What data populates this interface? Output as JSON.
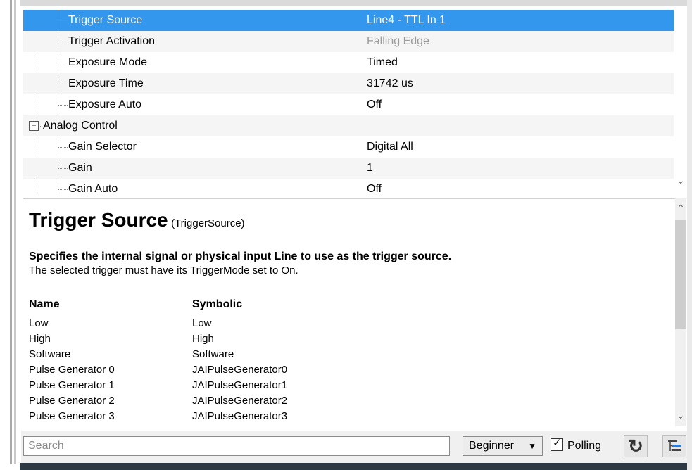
{
  "property_grid": {
    "rows": [
      {
        "name": "Trigger Source",
        "value": "Line4 - TTL In 1",
        "selected": true
      },
      {
        "name": "Trigger Activation",
        "value": "Falling Edge",
        "disabled": true
      },
      {
        "name": "Exposure Mode",
        "value": "Timed"
      },
      {
        "name": "Exposure Time",
        "value": "31742 us"
      },
      {
        "name": "Exposure Auto",
        "value": "Off"
      },
      {
        "name": "Analog Control",
        "category": true,
        "expanded": true
      },
      {
        "name": "Gain Selector",
        "value": "Digital All"
      },
      {
        "name": "Gain",
        "value": "1"
      },
      {
        "name": "Gain Auto",
        "value": "Off"
      }
    ]
  },
  "description": {
    "title": "Trigger Source",
    "symbol": "(TriggerSource)",
    "summary": "Specifies the internal signal or physical input Line to use as the trigger source.",
    "detail": "The selected trigger must have its TriggerMode set to On.",
    "columns": [
      "Name",
      "Symbolic"
    ],
    "entries": [
      [
        "Low",
        "Low"
      ],
      [
        "High",
        "High"
      ],
      [
        "Software",
        "Software"
      ],
      [
        "Pulse Generator 0",
        "JAIPulseGenerator0"
      ],
      [
        "Pulse Generator 1",
        "JAIPulseGenerator1"
      ],
      [
        "Pulse Generator 2",
        "JAIPulseGenerator2"
      ],
      [
        "Pulse Generator 3",
        "JAIPulseGenerator3"
      ]
    ]
  },
  "toolbar": {
    "search_placeholder": "Search",
    "visibility_level": "Beginner",
    "polling_label": "Polling",
    "polling_checked": true
  },
  "colors": {
    "selection": "#3397ee",
    "disabled_text": "#9a9a9a"
  },
  "icons": {
    "refresh": "refresh-icon",
    "tree_view": "tree-view-icon",
    "dropdown": "dropdown-arrow-icon",
    "collapse": "collapse-minus-icon"
  }
}
